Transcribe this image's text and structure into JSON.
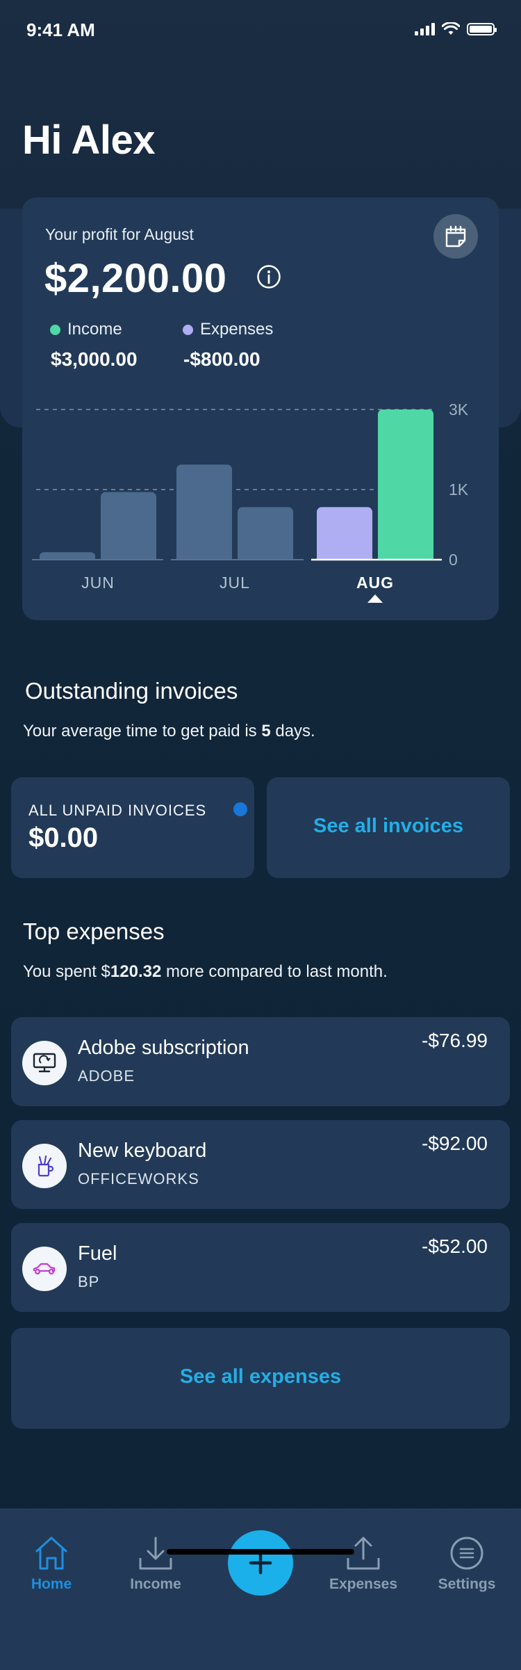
{
  "status_bar": {
    "time": "9:41 AM"
  },
  "greeting": "Hi Alex",
  "profit": {
    "label": "Your profit for August",
    "amount": "$2,200.00",
    "income_label": "Income",
    "income_value": "$3,000.00",
    "expenses_label": "Expenses",
    "expenses_value": "-$800.00"
  },
  "colors": {
    "income": "#4fd8a6",
    "expenses": "#b0aef2",
    "past_bar": "#4c6a8d",
    "accent": "#1cb0ea",
    "active_nav": "#1e8fe0"
  },
  "chart_data": {
    "type": "bar",
    "categories": [
      "JUN",
      "JUL",
      "AUG"
    ],
    "selected": "AUG",
    "series": [
      {
        "name": "Expenses",
        "values": [
          150,
          1900,
          1050
        ]
      },
      {
        "name": "Income",
        "values": [
          1350,
          1050,
          3000
        ]
      }
    ],
    "yticks": [
      "3K",
      "1K",
      "0"
    ],
    "ytick_values": [
      3000,
      1400,
      0
    ],
    "ylim": [
      0,
      3000
    ],
    "grid": true
  },
  "invoices": {
    "title": "Outstanding invoices",
    "subtitle_pre": "Your average time to get paid is ",
    "subtitle_bold": "5",
    "subtitle_post": " days.",
    "unpaid_label": "ALL UNPAID INVOICES",
    "unpaid_value": "$0.00",
    "see_all": "See all invoices"
  },
  "expenses": {
    "title": "Top expenses",
    "subtitle_pre": "You spent $",
    "subtitle_bold": "120.32",
    "subtitle_post": " more compared to last month.",
    "items": [
      {
        "name": "Adobe subscription",
        "vendor": "ADOBE",
        "amount": "-$76.99",
        "icon": "monitor-icon"
      },
      {
        "name": "New keyboard",
        "vendor": "OFFICEWORKS",
        "amount": "-$92.00",
        "icon": "pencil-cup-icon"
      },
      {
        "name": "Fuel",
        "vendor": "BP",
        "amount": "-$52.00",
        "icon": "car-icon"
      }
    ],
    "see_all": "See all expenses"
  },
  "nav": {
    "home": "Home",
    "income": "Income",
    "expenses": "Expenses",
    "settings": "Settings"
  }
}
